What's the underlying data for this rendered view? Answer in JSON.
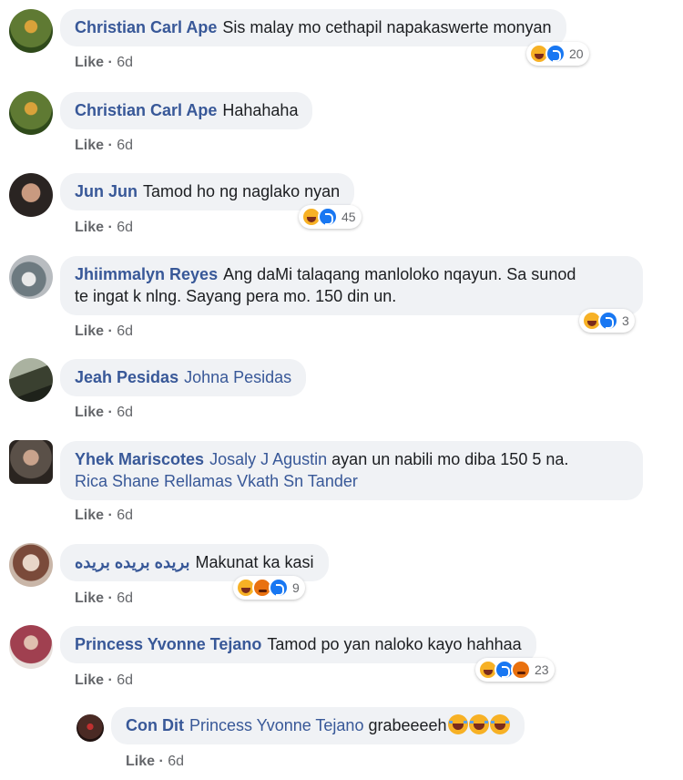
{
  "comments": [
    {
      "name": "Christian Carl Ape",
      "text": "Sis malay mo cethapil napakaswerte monyan",
      "tags": "",
      "like": "Like",
      "time": "6d",
      "reactions": [
        "haha",
        "like"
      ],
      "count": "20"
    },
    {
      "name": "Christian Carl Ape",
      "text": "Hahahaha",
      "tags": "",
      "like": "Like",
      "time": "6d",
      "reactions": [],
      "count": ""
    },
    {
      "name": "Jun Jun",
      "text": "Tamod ho ng naglako nyan",
      "tags": "",
      "like": "Like",
      "time": "6d",
      "reactions": [
        "haha",
        "like"
      ],
      "count": "45"
    },
    {
      "name": "Jhiimmalyn Reyes",
      "text": "Ang daMi talaqang manloloko nqayun. Sa sunod",
      "text2": "te ingat k nlng. Sayang pera mo. 150 din un.",
      "tags": "",
      "like": "Like",
      "time": "6d",
      "reactions": [
        "haha",
        "like"
      ],
      "count": "3"
    },
    {
      "name": "Jeah Pesidas",
      "text": "",
      "tags": "Johna Pesidas",
      "like": "Like",
      "time": "6d",
      "reactions": [],
      "count": ""
    },
    {
      "name": "Yhek Mariscotes",
      "tags": "Josaly J Agustin",
      "text": "ayan un nabili mo diba 150 5 na.",
      "tags2": "Rica Shane Rellamas Vkath Sn Tander",
      "like": "Like",
      "time": "6d",
      "reactions": [],
      "count": ""
    },
    {
      "name": "بريده بريده بريده",
      "text": "Makunat ka kasi",
      "tags": "",
      "like": "Like",
      "time": "6d",
      "reactions": [
        "haha",
        "angry",
        "like"
      ],
      "count": "9"
    },
    {
      "name": "Princess Yvonne Tejano",
      "text": "Tamod po yan naloko kayo hahhaa",
      "tags": "",
      "like": "Like",
      "time": "6d",
      "reactions": [
        "haha",
        "like",
        "angry"
      ],
      "count": "23"
    },
    {
      "name": "Con Dit",
      "tags": "Princess Yvonne Tejano",
      "text": "grabeeeeh",
      "like": "Like",
      "time": "6d",
      "reactions": [],
      "count": ""
    }
  ],
  "avatar_colors": [
    "#6b7a3a",
    "#6b7a3a",
    "#3b3230",
    "#8a8f98",
    "#3a4030",
    "#5a5048",
    "#b89a86",
    "#a04050",
    "#4a2a24"
  ]
}
